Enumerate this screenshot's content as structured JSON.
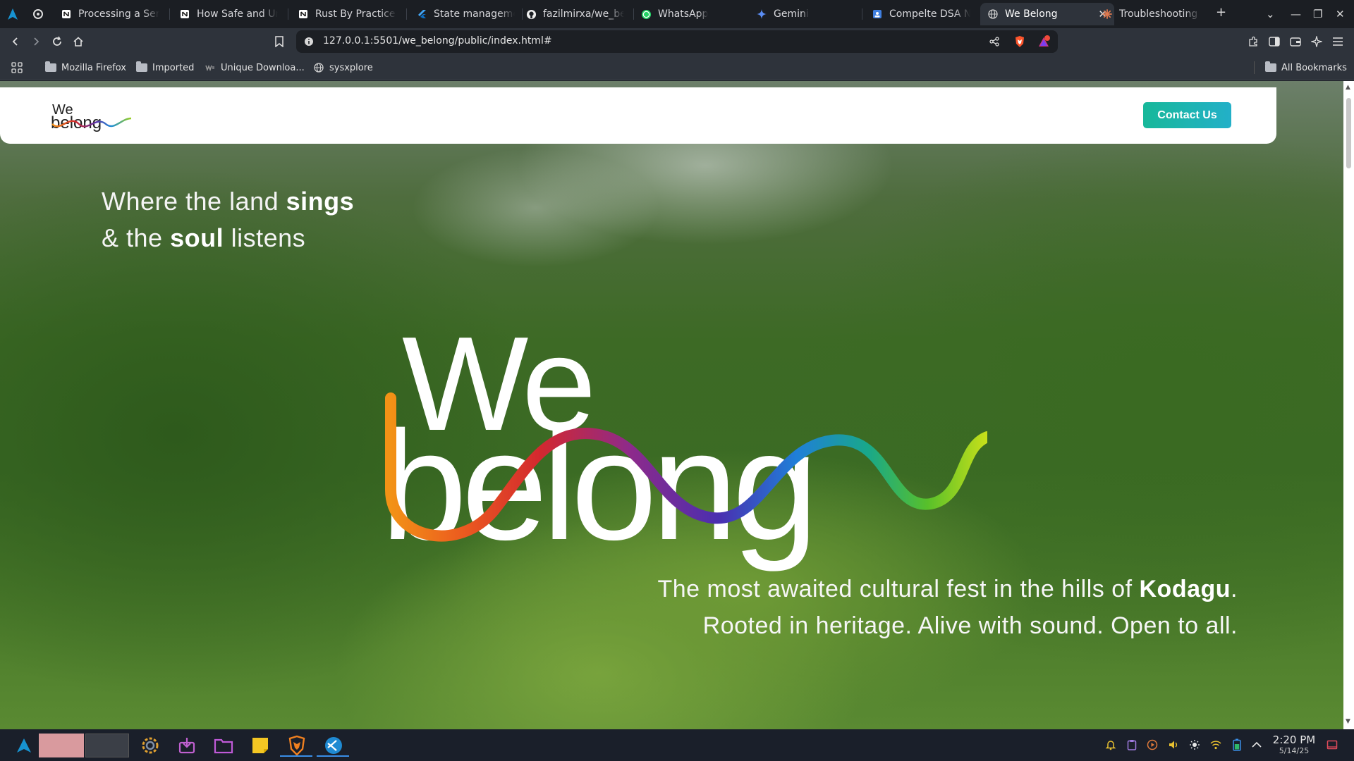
{
  "tabs": [
    {
      "label": "Processing a Series",
      "icon": "notion-icon"
    },
    {
      "label": "How Safe and Unsafe",
      "icon": "notion-icon"
    },
    {
      "label": "Rust By Practice - R",
      "icon": "notion-icon"
    },
    {
      "label": "State management",
      "icon": "flutter-icon"
    },
    {
      "label": "fazilmirxa/we_belong",
      "icon": "github-icon"
    },
    {
      "label": "WhatsApp",
      "icon": "whatsapp-icon"
    },
    {
      "label": "Gemini",
      "icon": "gemini-icon"
    },
    {
      "label": "Compelte DSA Notes",
      "icon": "doc-icon"
    },
    {
      "label": "We Belong",
      "icon": "globe-icon"
    },
    {
      "label": "Troubleshooting N",
      "icon": "claude-icon"
    }
  ],
  "address": {
    "url": "127.0.0.1:5501/we_belong/public/index.html#"
  },
  "bookmarks": {
    "items": [
      "Mozilla Firefox",
      "Imported",
      "Unique Downloa...",
      "sysxplore"
    ],
    "all": "All Bookmarks"
  },
  "site": {
    "logo_top": "We",
    "logo_bottom": "belong",
    "contact": "Contact Us",
    "tagline_left": {
      "line1_pre": "Where the land ",
      "line1_bold": "sings",
      "line2_pre": "& the ",
      "line2_bold": "soul",
      "line2_post": " listens"
    },
    "hero_top": "We",
    "hero_bottom": "belong",
    "tagline_right": {
      "line1_pre": "The most awaited cultural fest in the hills of ",
      "line1_bold": "Kodagu",
      "line1_post": ".",
      "line2": "Rooted in heritage. Alive with sound. Open to all."
    }
  },
  "taskbar": {
    "time": "2:20 PM",
    "date": "5/14/25",
    "colors": {
      "accent": "#3a8ee6",
      "workspace_active": "#d99a9e"
    }
  }
}
